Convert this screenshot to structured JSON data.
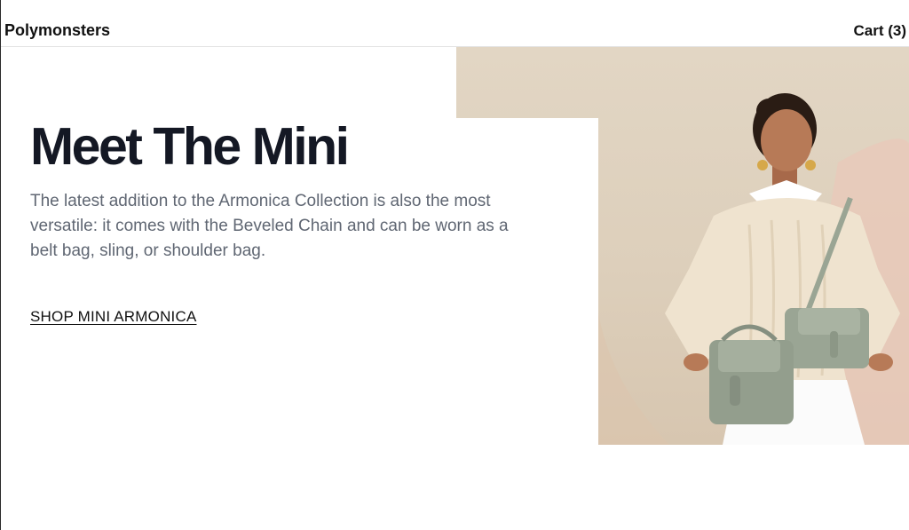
{
  "header": {
    "brand": "Polymonsters",
    "cart_label": "Cart (3)"
  },
  "hero": {
    "title": "Meet The Mini",
    "description": "The latest addition to the Armonica Collection is also the most versatile: it comes with the Beveled Chain and can be worn as a belt bag, sling, or shoulder bag.",
    "cta_label": "SHOP MINI ARMONICA",
    "image_alt": "Model wearing a cream cable-knit sweater holding two sage green mini bags"
  },
  "colors": {
    "headline": "#141824",
    "body_text": "#606773",
    "bag": "#9aa594",
    "sweater": "#efe3cf",
    "backdrop": "#e2d6c4"
  }
}
